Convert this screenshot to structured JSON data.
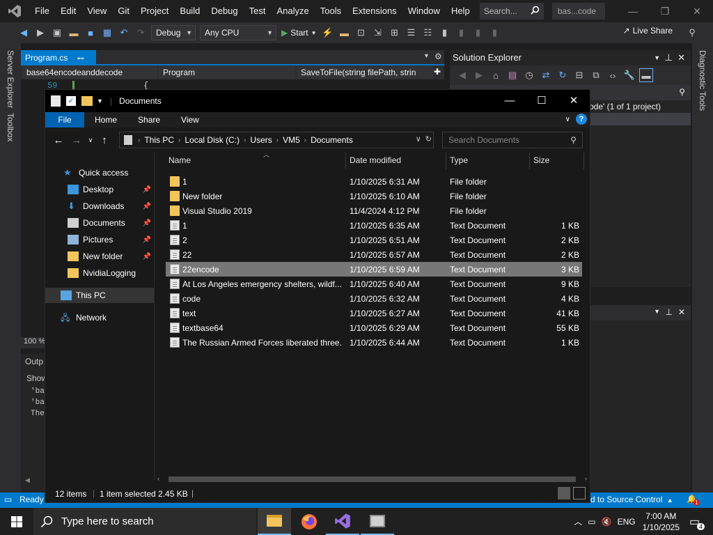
{
  "vs": {
    "menu": [
      "File",
      "Edit",
      "View",
      "Git",
      "Project",
      "Build",
      "Debug",
      "Test",
      "Analyze",
      "Tools",
      "Extensions",
      "Window",
      "Help"
    ],
    "search_placeholder": "Search...",
    "solution_name": "bas...code",
    "toolbar": {
      "config": "Debug",
      "platform": "Any CPU",
      "start": "Start",
      "live_share": "Live Share"
    },
    "rail_left": [
      "Server Explorer",
      "Toolbox"
    ],
    "rail_right": "Diagnostic Tools",
    "editor": {
      "tab": "Program.cs",
      "nav_project": "base64encodeanddecode",
      "nav_class": "Program",
      "nav_member": "SaveToFile(string filePath, strin",
      "line_number": "59",
      "line_code": "{"
    },
    "solution_explorer": {
      "title": "Solution Explorer",
      "item": "ode' (1 of 1 project)"
    },
    "zoom": "100 %",
    "output": {
      "title": "Outp",
      "show": "Show",
      "lines": [
        "'ba",
        "'ba",
        "The"
      ]
    },
    "status": {
      "ready": "Ready",
      "source_control": "d to Source Control",
      "notifications": "1"
    }
  },
  "explorer": {
    "title": "Documents",
    "ribbon_tabs": [
      "File",
      "Home",
      "Share",
      "View"
    ],
    "breadcrumbs": [
      "This PC",
      "Local Disk (C:)",
      "Users",
      "VM5",
      "Documents"
    ],
    "search_placeholder": "Search Documents",
    "sidebar": [
      {
        "label": "Quick access",
        "icon": "star-icon",
        "pinned": false
      },
      {
        "label": "Desktop",
        "icon": "desktop-icon",
        "pinned": true
      },
      {
        "label": "Downloads",
        "icon": "download-icon",
        "pinned": true
      },
      {
        "label": "Documents",
        "icon": "documents-icon",
        "pinned": true
      },
      {
        "label": "Pictures",
        "icon": "pictures-icon",
        "pinned": true
      },
      {
        "label": "New folder",
        "icon": "folder-icon",
        "pinned": true
      },
      {
        "label": "NvidiaLogging",
        "icon": "folder-icon",
        "pinned": false
      },
      {
        "label": "This PC",
        "icon": "computer-icon",
        "pinned": false
      },
      {
        "label": "Network",
        "icon": "network-icon",
        "pinned": false
      }
    ],
    "columns": [
      "Name",
      "Date modified",
      "Type",
      "Size"
    ],
    "files": [
      {
        "name": "1",
        "date": "1/10/2025 6:31 AM",
        "type": "File folder",
        "size": "",
        "kind": "folder"
      },
      {
        "name": "New folder",
        "date": "1/10/2025 6:10 AM",
        "type": "File folder",
        "size": "",
        "kind": "folder"
      },
      {
        "name": "Visual Studio 2019",
        "date": "11/4/2024 4:12 PM",
        "type": "File folder",
        "size": "",
        "kind": "folder"
      },
      {
        "name": "1",
        "date": "1/10/2025 6:35 AM",
        "type": "Text Document",
        "size": "1 KB",
        "kind": "doc"
      },
      {
        "name": "2",
        "date": "1/10/2025 6:51 AM",
        "type": "Text Document",
        "size": "2 KB",
        "kind": "doc"
      },
      {
        "name": "22",
        "date": "1/10/2025 6:57 AM",
        "type": "Text Document",
        "size": "2 KB",
        "kind": "doc"
      },
      {
        "name": "22encode",
        "date": "1/10/2025 6:59 AM",
        "type": "Text Document",
        "size": "3 KB",
        "kind": "doc",
        "selected": true
      },
      {
        "name": "At Los Angeles emergency shelters, wildf...",
        "date": "1/10/2025 6:40 AM",
        "type": "Text Document",
        "size": "9 KB",
        "kind": "doc"
      },
      {
        "name": "code",
        "date": "1/10/2025 6:32 AM",
        "type": "Text Document",
        "size": "4 KB",
        "kind": "doc"
      },
      {
        "name": "text",
        "date": "1/10/2025 6:27 AM",
        "type": "Text Document",
        "size": "41 KB",
        "kind": "doc"
      },
      {
        "name": "textbase64",
        "date": "1/10/2025 6:29 AM",
        "type": "Text Document",
        "size": "55 KB",
        "kind": "doc"
      },
      {
        "name": "The Russian Armed Forces liberated three...",
        "date": "1/10/2025 6:44 AM",
        "type": "Text Document",
        "size": "1 KB",
        "kind": "doc"
      }
    ],
    "status": {
      "items": "12 items",
      "selection": "1 item selected  2.45 KB"
    }
  },
  "taskbar": {
    "search_placeholder": "Type here to search",
    "apps": [
      "file-explorer-icon",
      "firefox-icon",
      "visual-studio-icon",
      "remote-desktop-icon"
    ],
    "language": "ENG",
    "time": "7:00 AM",
    "date": "1/10/2025",
    "notification_count": "4"
  },
  "colors": {
    "vs_accent": "#007acc",
    "selection": "#777777",
    "folder": "#f2c55c"
  }
}
